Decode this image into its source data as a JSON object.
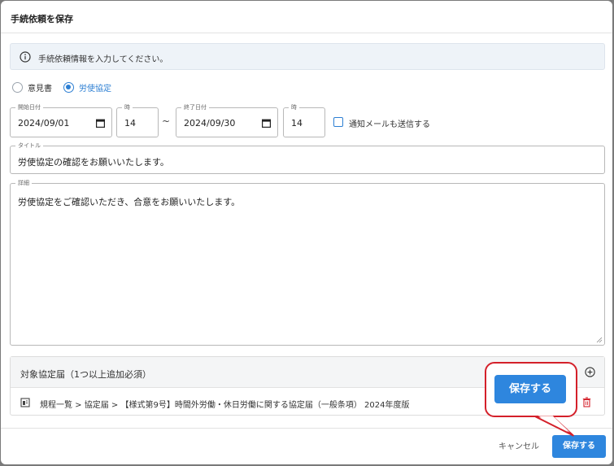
{
  "dialog": {
    "title": "手続依頼を保存"
  },
  "info": {
    "text": "手続依頼情報を入力してください。",
    "icon": "info-icon"
  },
  "type_options": [
    {
      "label": "意見書",
      "selected": false
    },
    {
      "label": "労使協定",
      "selected": true
    }
  ],
  "start": {
    "date_label": "開始日付",
    "date_value": "2024/09/01",
    "hour_label": "時",
    "hour_value": "14"
  },
  "end": {
    "date_label": "終了日付",
    "date_value": "2024/09/30",
    "hour_label": "時",
    "hour_value": "14"
  },
  "range_separator": "~",
  "notify": {
    "label": "通知メールも送信する",
    "checked": false
  },
  "title_field": {
    "label": "タイトル",
    "value": "労使協定の確認をお願いいたします。"
  },
  "detail_field": {
    "label": "詳細",
    "value": "労使協定をご確認いただき、合意をお願いいたします。"
  },
  "agreements": {
    "header": "対象協定届（1つ以上追加必須）",
    "items": [
      {
        "text": "規程一覧 > 協定届 > 【様式第9号】時間外労働・休日労働に関する協定届（一般条項） 2024年度版"
      }
    ]
  },
  "footer": {
    "cancel_label": "キャンセル",
    "save_label": "保存する"
  },
  "callout": {
    "button_label": "保存する"
  },
  "colors": {
    "accent": "#2e86de",
    "callout_border": "#d4202a",
    "delete": "#d4202a"
  }
}
